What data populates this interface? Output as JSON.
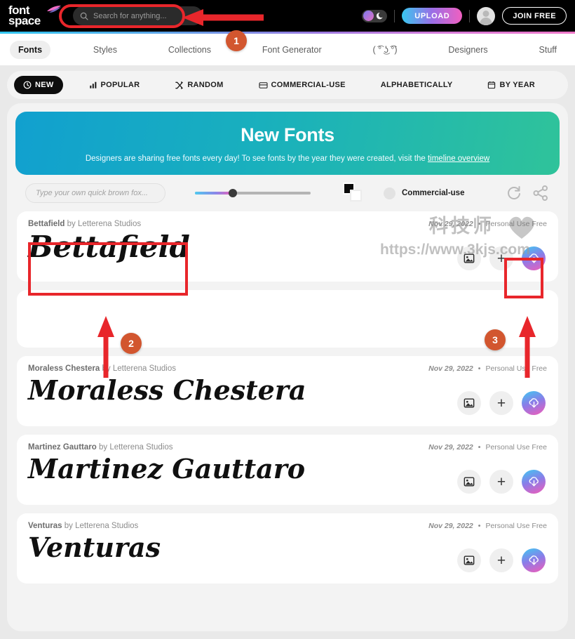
{
  "header": {
    "logo_line1": "font",
    "logo_line2": "space",
    "logo_icon": "swoosh-icon",
    "search_placeholder": "Search for anything...",
    "search_value": "",
    "search_icon": "search-icon",
    "mode_toggle_icon": "moon-icon",
    "upload_label": "UPLOAD",
    "avatar_icon": "user-avatar-icon",
    "join_label": "JOIN FREE"
  },
  "nav": {
    "items": [
      {
        "label": "Fonts",
        "active": true
      },
      {
        "label": "Styles",
        "active": false
      },
      {
        "label": "Collections",
        "active": false
      },
      {
        "label": "Font Generator",
        "active": false
      },
      {
        "label": "( ͡° ͜ʖ ͡°)",
        "active": false
      },
      {
        "label": "Designers",
        "active": false
      },
      {
        "label": "Stuff",
        "active": false
      }
    ]
  },
  "filters": [
    {
      "label": "NEW",
      "icon": "clock-icon",
      "active": true
    },
    {
      "label": "POPULAR",
      "icon": "bar-chart-icon",
      "active": false
    },
    {
      "label": "RANDOM",
      "icon": "shuffle-icon",
      "active": false
    },
    {
      "label": "COMMERCIAL-USE",
      "icon": "card-icon",
      "active": false
    },
    {
      "label": "ALPHABETICALLY",
      "icon": "none",
      "active": false
    },
    {
      "label": "BY YEAR",
      "icon": "calendar-icon",
      "active": false
    }
  ],
  "banner": {
    "title": "New Fonts",
    "subtitle_before": "Designers are sharing free fonts every day! To see fonts by the year they were created, visit the ",
    "link_label": "timeline overview",
    "gradient_from": "#11a0cf",
    "gradient_to": "#2fc39a"
  },
  "controls": {
    "preview_placeholder": "Type your own quick brown fox...",
    "preview_value": "",
    "size_slider_percent": 30,
    "color_swatch_fg": "#0b0b0b",
    "color_swatch_bg": "#ffffff",
    "commercial_label": "Commercial-use",
    "commercial_checked": false,
    "refresh_icon": "refresh-icon",
    "share_icon": "share-icon"
  },
  "font_cards": [
    {
      "name": "Bettafield",
      "by_prefix": " by ",
      "designer": "Letterena Studios",
      "date": "Nov 29, 2022",
      "separator": "•",
      "license": "Personal Use Free",
      "sample_text": "Bettafield",
      "sample_size": 42,
      "highlighted": true,
      "blank": false,
      "actions": [
        "image-preview-icon",
        "add-to-collection-icon",
        "download-icon"
      ]
    },
    {
      "name": "",
      "by_prefix": "",
      "designer": "",
      "date": "",
      "separator": "",
      "license": "",
      "sample_text": "",
      "sample_size": 0,
      "highlighted": false,
      "blank": true,
      "actions": []
    },
    {
      "name": "Moraless Chestera",
      "by_prefix": " by ",
      "designer": "Letterena Studios",
      "date": "Nov 29, 2022",
      "separator": "•",
      "license": "Personal Use Free",
      "sample_text": "Moraless Chestera",
      "sample_size": 38,
      "highlighted": false,
      "blank": false,
      "actions": [
        "image-preview-icon",
        "add-to-collection-icon",
        "download-icon"
      ]
    },
    {
      "name": "Martinez Gauttaro",
      "by_prefix": " by ",
      "designer": "Letterena Studios",
      "date": "Nov 29, 2022",
      "separator": "•",
      "license": "Personal Use Free",
      "sample_text": "Martinez Gauttaro",
      "sample_size": 38,
      "highlighted": false,
      "blank": false,
      "actions": [
        "image-preview-icon",
        "add-to-collection-icon",
        "download-icon"
      ]
    },
    {
      "name": "Venturas",
      "by_prefix": " by ",
      "designer": "Letterena Studios",
      "date": "Nov 29, 2022",
      "separator": "•",
      "license": "Personal Use Free",
      "sample_text": "Venturas",
      "sample_size": 38,
      "highlighted": false,
      "blank": false,
      "actions": [
        "image-preview-icon",
        "add-to-collection-icon",
        "download-icon"
      ]
    }
  ],
  "annotations": {
    "badge1": "1",
    "badge2": "2",
    "badge3": "3",
    "box_color": "#e8262b",
    "badge_color": "#d2562f"
  },
  "watermark": {
    "cn_text": "科技师",
    "url_text": "https://www.3kjs.com",
    "heart_icon": "heart-icon"
  }
}
